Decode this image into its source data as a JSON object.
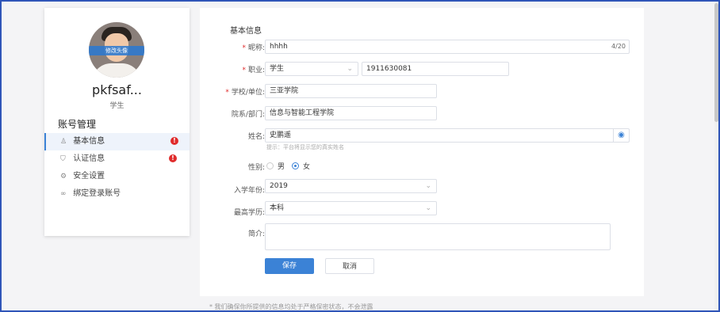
{
  "sidebar": {
    "avatar_edit_label": "修改头像",
    "username": "pkfsaf...",
    "role": "学生",
    "account_title": "账号管理",
    "items": [
      {
        "label": "基本信息",
        "icon": "user-icon",
        "alert": "!"
      },
      {
        "label": "认证信息",
        "icon": "shield-icon",
        "alert": "!"
      },
      {
        "label": "安全设置",
        "icon": "gear-icon"
      },
      {
        "label": "绑定登录账号",
        "icon": "link-icon"
      }
    ]
  },
  "form": {
    "section_title": "基本信息",
    "nickname": {
      "label": "昵称:",
      "value": "hhhh",
      "counter": "4/20"
    },
    "occupation": {
      "label": "职业:",
      "value": "学生",
      "id_value": "1911630081"
    },
    "school": {
      "label": "学校/单位:",
      "value": "三亚学院"
    },
    "department": {
      "label": "院系/部门:",
      "value": "信息与智能工程学院"
    },
    "name": {
      "label": "姓名:",
      "value": "史鹏遥",
      "hint": "提示：平台将显示您的真实姓名"
    },
    "gender": {
      "label": "性别:",
      "options": [
        "男",
        "女"
      ],
      "selected": "女"
    },
    "enroll_year": {
      "label": "入学年份:",
      "value": "2019"
    },
    "education": {
      "label": "最高学历:",
      "value": "本科"
    },
    "bio": {
      "label": "简介:",
      "value": ""
    },
    "save_label": "保存",
    "cancel_label": "取消"
  },
  "footer_note": "* 我们确保你所提供的信息均处于严格保密状态，不会泄露",
  "colors": {
    "accent": "#3b82d6",
    "required": "#e02b2b",
    "frame": "#2f55b8"
  }
}
